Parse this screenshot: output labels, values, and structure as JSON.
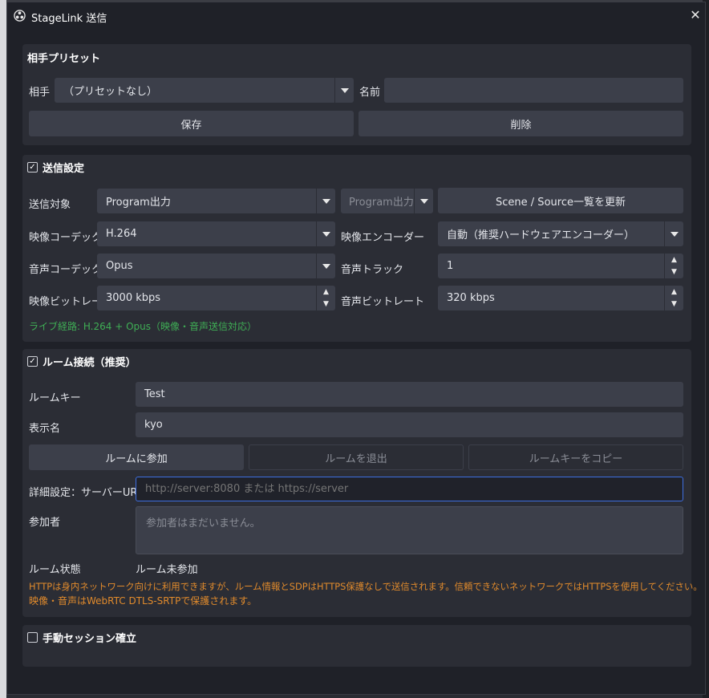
{
  "window": {
    "title": "StageLink 送信",
    "close_glyph": "✕"
  },
  "preset": {
    "group_title": "相手プリセット",
    "partner_label": "相手",
    "partner_value": "（プリセットなし）",
    "name_label": "名前",
    "name_value": "",
    "save_label": "保存",
    "delete_label": "削除"
  },
  "send": {
    "group_title": "送信設定",
    "checked": true,
    "target_label": "送信対象",
    "target_value": "Program出力",
    "target_sub_value": "Program出力",
    "refresh_label": "Scene / Source一覧を更新",
    "vcodec_label": "映像コーデック",
    "vcodec_value": "H.264",
    "vencoder_label": "映像エンコーダー",
    "vencoder_value": "自動（推奨ハードウェアエンコーダー）",
    "acodec_label": "音声コーデック",
    "acodec_value": "Opus",
    "atrack_label": "音声トラック",
    "atrack_value": "1",
    "vbitrate_label": "映像ビットレート",
    "vbitrate_value": "3000 kbps",
    "abitrate_label": "音声ビットレート",
    "abitrate_value": "320 kbps",
    "route_note": "ライブ経路: H.264 + Opus（映像・音声送信対応）"
  },
  "room": {
    "group_title": "ルーム接続（推奨）",
    "checked": true,
    "key_label": "ルームキー",
    "key_value": "Test",
    "display_label": "表示名",
    "display_value": "kyo",
    "join_label": "ルームに参加",
    "leave_label": "ルームを退出",
    "copy_label": "ルームキーをコピー",
    "server_label": "詳細設定：サーバーURL",
    "server_placeholder": "http://server:8080 または https://server",
    "participants_label": "参加者",
    "participants_placeholder": "参加者はまだいません。",
    "state_label": "ルーム状態",
    "state_value": "ルーム未参加",
    "warning_line1": "HTTPは身内ネットワーク向けに利用できますが、ルーム情報とSDPはHTTPS保護なしで送信されます。信頼できないネットワークではHTTPSを使用してください。",
    "warning_line2": "映像・音声はWebRTC DTLS-SRTPで保護されます。"
  },
  "manual": {
    "group_title": "手動セッション確立",
    "checked": false
  },
  "colors": {
    "accent_green": "#3fae55",
    "warning_orange": "#e08a2c",
    "focus_blue": "#3d6ee0"
  }
}
